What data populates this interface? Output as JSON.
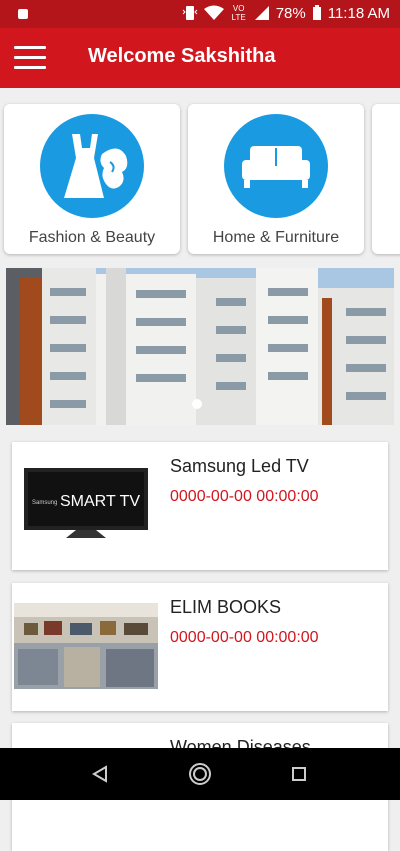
{
  "status_bar": {
    "time": "11:18 AM",
    "battery": "78%",
    "network": "VO LTE"
  },
  "app_bar": {
    "title": "Welcome Sakshitha"
  },
  "categories": [
    {
      "label": "Fashion & Beauty",
      "icon": "dress-icon"
    },
    {
      "label": "Home & Furniture",
      "icon": "sofa-icon"
    }
  ],
  "banner": {
    "icon": "apartment-building-image"
  },
  "products": [
    {
      "name": "Samsung Led TV",
      "date": "0000-00-00 00:00:00",
      "image": "smart-tv-image",
      "image_text": "SMART TV",
      "brand": "Samsung"
    },
    {
      "name": "ELIM BOOKS",
      "date": "0000-00-00 00:00:00",
      "image": "bookstore-image"
    },
    {
      "name": "Women Diseases",
      "image": "book-cover-image"
    }
  ],
  "colors": {
    "primary": "#d2161e",
    "status_bar": "#b3151b",
    "category_circle": "#1a9ae0"
  }
}
